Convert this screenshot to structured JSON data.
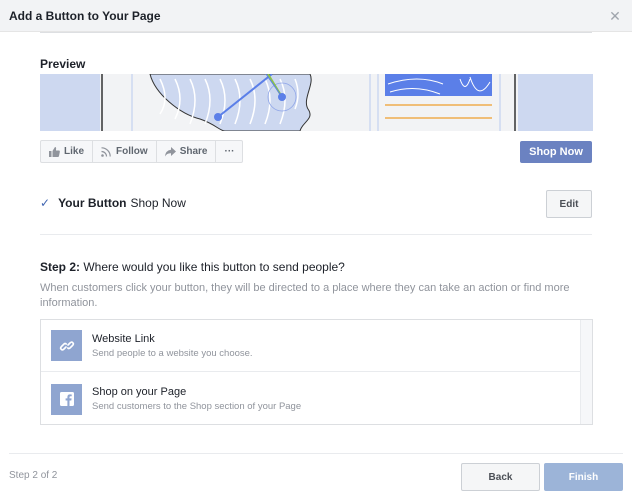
{
  "dialog": {
    "title": "Add a Button to Your Page",
    "close_icon": "close-icon"
  },
  "preview": {
    "title": "Preview",
    "actions": [
      {
        "label": "Like",
        "icon": "thumbs-up-icon"
      },
      {
        "label": "Follow",
        "icon": "rss-icon"
      },
      {
        "label": "Share",
        "icon": "share-arrow-icon"
      },
      {
        "label": "···",
        "icon": "more-icon"
      }
    ],
    "cta_label": "Shop Now",
    "colors": {
      "cta": "#6b82c1",
      "cover_blue": "#cdd8f0",
      "accent_blue": "#5b7fe8",
      "accent_orange": "#f0ad4e",
      "accent_green": "#8bc34a"
    }
  },
  "your_button": {
    "check_icon": "✓",
    "label": "Your Button",
    "value": "Shop Now",
    "edit_label": "Edit"
  },
  "step2": {
    "prefix": "Step 2:",
    "question": " Where would you like this button to send people?",
    "description": "When customers click your button, they will be directed to a place where they can take an action or find more information.",
    "options": [
      {
        "title": "Website Link",
        "subtitle": "Send people to a website you choose.",
        "icon": "link-icon"
      },
      {
        "title": "Shop on your Page",
        "subtitle": "Send customers to the Shop section of your Page",
        "icon": "facebook-icon"
      }
    ]
  },
  "footer": {
    "step_count": "Step 2 of 2",
    "back_label": "Back",
    "finish_label": "Finish"
  }
}
